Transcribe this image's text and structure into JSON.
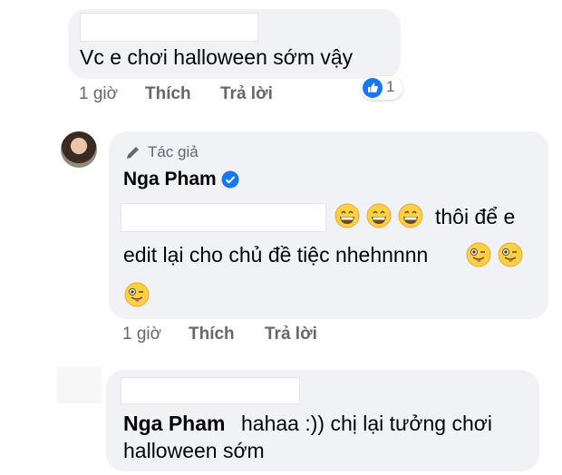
{
  "comments": [
    {
      "text": "Vc e chơi halloween sớm vậy",
      "meta": {
        "time": "1 giờ",
        "like": "Thích",
        "reply": "Trả lời"
      },
      "reactions": {
        "icon": "thumbs-up-icon",
        "count": "1"
      }
    }
  ],
  "reply": {
    "author_badge": "Tác giả",
    "author": "Nga Pham",
    "text_line1": "thôi để e",
    "text_line2": "edit lại cho chủ đề tiệc nhehnnnn",
    "meta": {
      "time": "1 giờ",
      "like": "Thích",
      "reply": "Trả lời"
    }
  },
  "reply2": {
    "mention": "Nga Pham",
    "text_line1": "hahaa :)) chị lại tưởng chơi",
    "text_line2": "halloween sớm"
  },
  "colors": {
    "bubble": "#f0f2f5",
    "meta": "#65676b",
    "like_blue": "#1877f2"
  }
}
